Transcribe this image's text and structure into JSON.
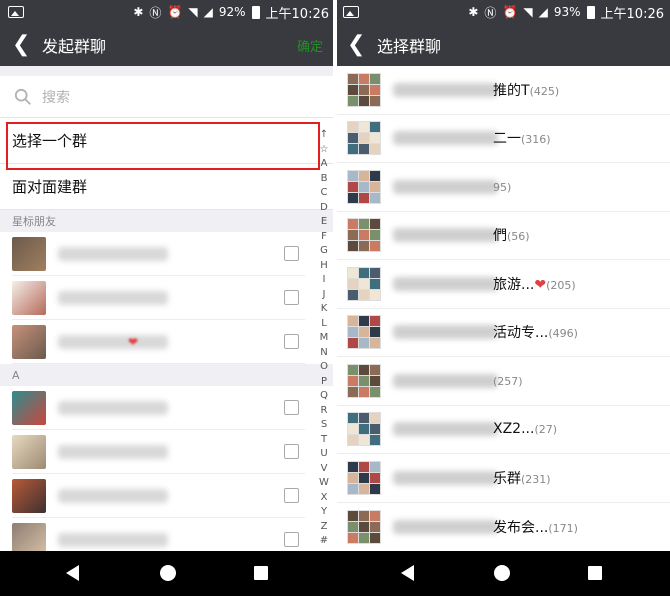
{
  "left": {
    "status": {
      "battery": "92%",
      "time": "上午10:26"
    },
    "title": "发起群聊",
    "confirm": "确定",
    "search_placeholder": "搜索",
    "options": [
      {
        "label": "选择一个群",
        "selected": true
      },
      {
        "label": "面对面建群",
        "selected": false
      }
    ],
    "sections": [
      {
        "header": "星标朋友",
        "contacts": [
          {
            "colors": [
              "#6b5a4a",
              "#a08060"
            ]
          },
          {
            "colors": [
              "#f4efe8",
              "#b46a5a"
            ]
          },
          {
            "colors": [
              "#c7927b",
              "#6a5a4e"
            ],
            "heart": "❤"
          }
        ]
      },
      {
        "header": "A",
        "contacts": [
          {
            "colors": [
              "#2f8d8f",
              "#c9463d"
            ]
          },
          {
            "colors": [
              "#e7d9c1",
              "#9d8a72"
            ]
          },
          {
            "colors": [
              "#b85a3a",
              "#3e3030"
            ]
          },
          {
            "colors": [
              "#8e7e72",
              "#d7c2a8"
            ]
          }
        ]
      }
    ],
    "index": [
      "↑",
      "☆",
      "A",
      "B",
      "C",
      "D",
      "E",
      "F",
      "G",
      "H",
      "I",
      "J",
      "K",
      "L",
      "M",
      "N",
      "O",
      "P",
      "Q",
      "R",
      "S",
      "T",
      "U",
      "V",
      "W",
      "X",
      "Y",
      "Z",
      "#"
    ]
  },
  "right": {
    "status": {
      "battery": "93%",
      "time": "上午10:26"
    },
    "title": "选择群聊",
    "groups": [
      {
        "name": "推的T",
        "count": "(425)"
      },
      {
        "name": "二一",
        "count": "(316)"
      },
      {
        "name": "",
        "count": "95)"
      },
      {
        "name": "們",
        "count": "(56)"
      },
      {
        "name": "旅游...",
        "count": "(205)",
        "heart": "❤"
      },
      {
        "name": "活动专...",
        "count": "(496)"
      },
      {
        "name": "",
        "count": "(257)"
      },
      {
        "name": "XZ2...",
        "count": "(27)"
      },
      {
        "name": "乐群",
        "count": "(231)"
      },
      {
        "name": "发布会...",
        "count": "(171)"
      }
    ]
  },
  "icons": {
    "back": "back-arrow-icon",
    "search": "search-icon",
    "nav_back": "nav-back-icon",
    "nav_home": "nav-home-icon",
    "nav_recents": "nav-recents-icon"
  },
  "colors": {
    "header": "#393a3f",
    "accent": "#1aad19",
    "highlight": "#e02020",
    "section_bg": "#efeff4"
  }
}
